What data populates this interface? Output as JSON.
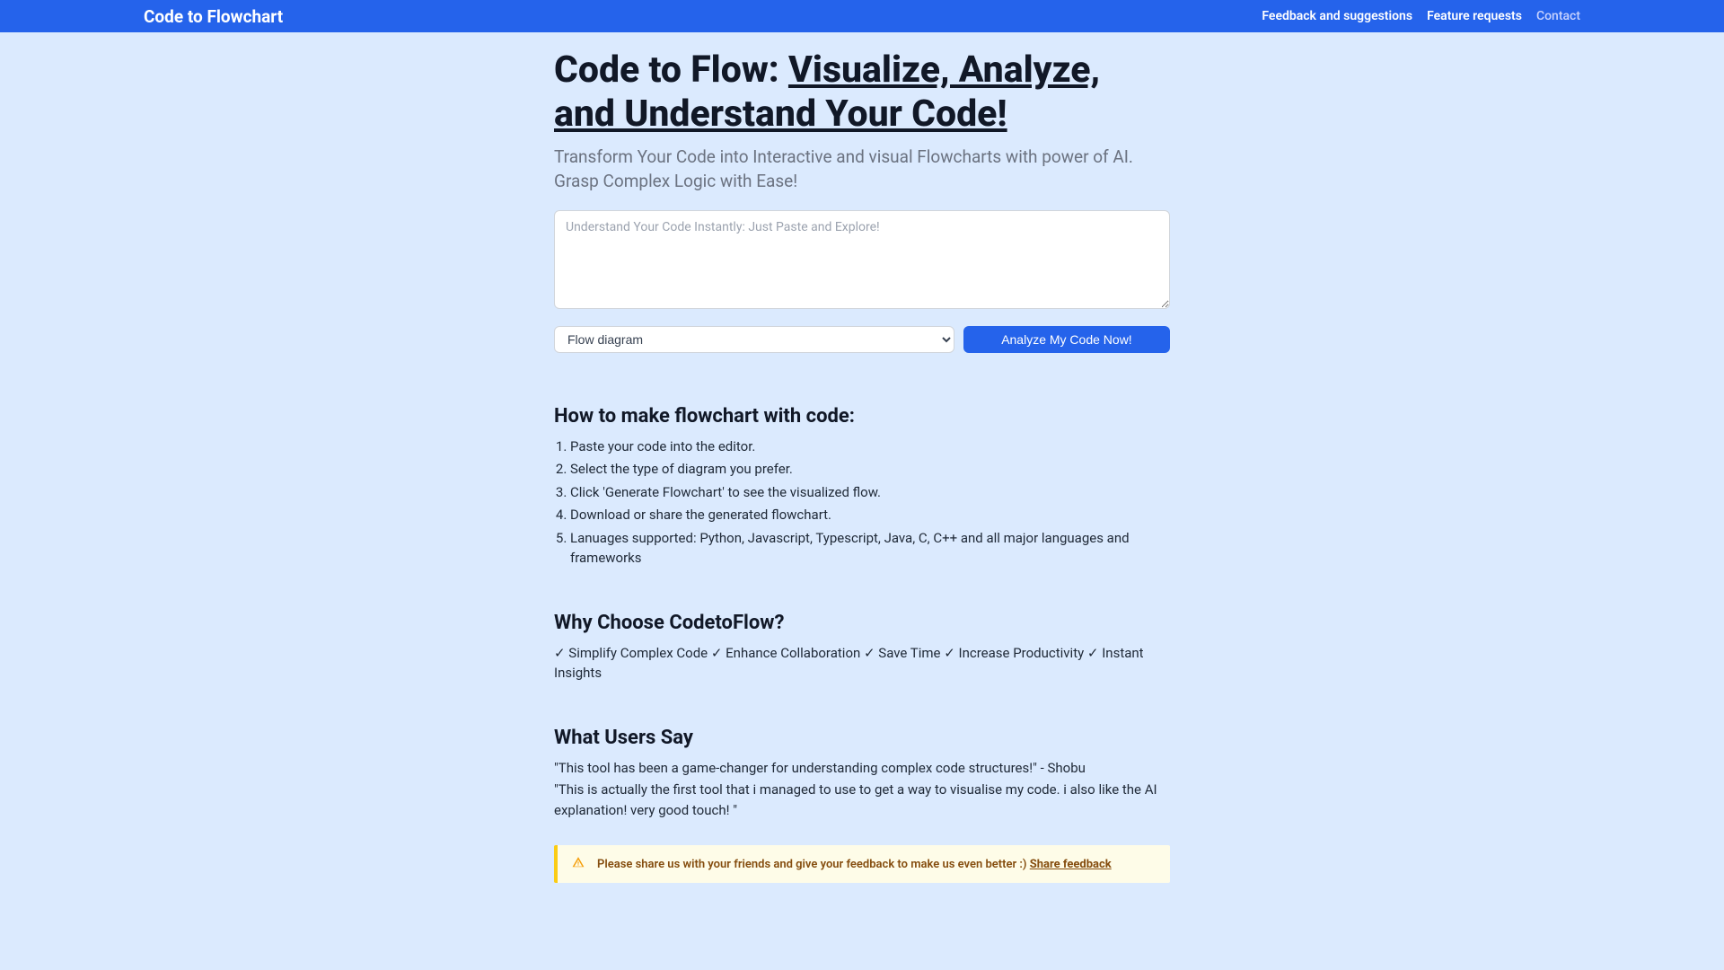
{
  "header": {
    "logo": "Code to Flowchart",
    "nav": {
      "feedback": "Feedback and suggestions",
      "feature_requests": "Feature requests",
      "contact": "Contact"
    }
  },
  "hero": {
    "title_prefix": "Code to Flow: ",
    "title_underline": "Visualize, Analyze, and Understand Your Code!",
    "subtitle": "Transform Your Code into Interactive and visual Flowcharts with power of AI. Grasp Complex Logic with Ease!"
  },
  "form": {
    "textarea_placeholder": "Understand Your Code Instantly: Just Paste and Explore!",
    "select_value": "Flow diagram",
    "analyze_button": "Analyze My Code Now!"
  },
  "howto": {
    "title": "How to make flowchart with code:",
    "steps": [
      "Paste your code into the editor.",
      "Select the type of diagram you prefer.",
      "Click 'Generate Flowchart' to see the visualized flow.",
      "Download or share the generated flowchart.",
      "Lanuages supported: Python, Javascript, Typescript, Java, C, C++ and all major languages and frameworks"
    ]
  },
  "why": {
    "title": "Why Choose CodetoFlow?",
    "benefits": "✓ Simplify Complex Code ✓ Enhance Collaboration ✓ Save Time ✓ Increase Productivity ✓ Instant Insights"
  },
  "testimonials": {
    "title": "What Users Say",
    "items": [
      "\"This tool has been a game-changer for understanding complex code structures!\" - Shobu",
      "\"This is actually the first tool that i managed to use to get a way to visualise my code. i also like the AI explanation! very good touch! \""
    ]
  },
  "alert": {
    "text": "Please share us with your friends and give your feedback to make us even better :) ",
    "link": "Share feedback"
  }
}
